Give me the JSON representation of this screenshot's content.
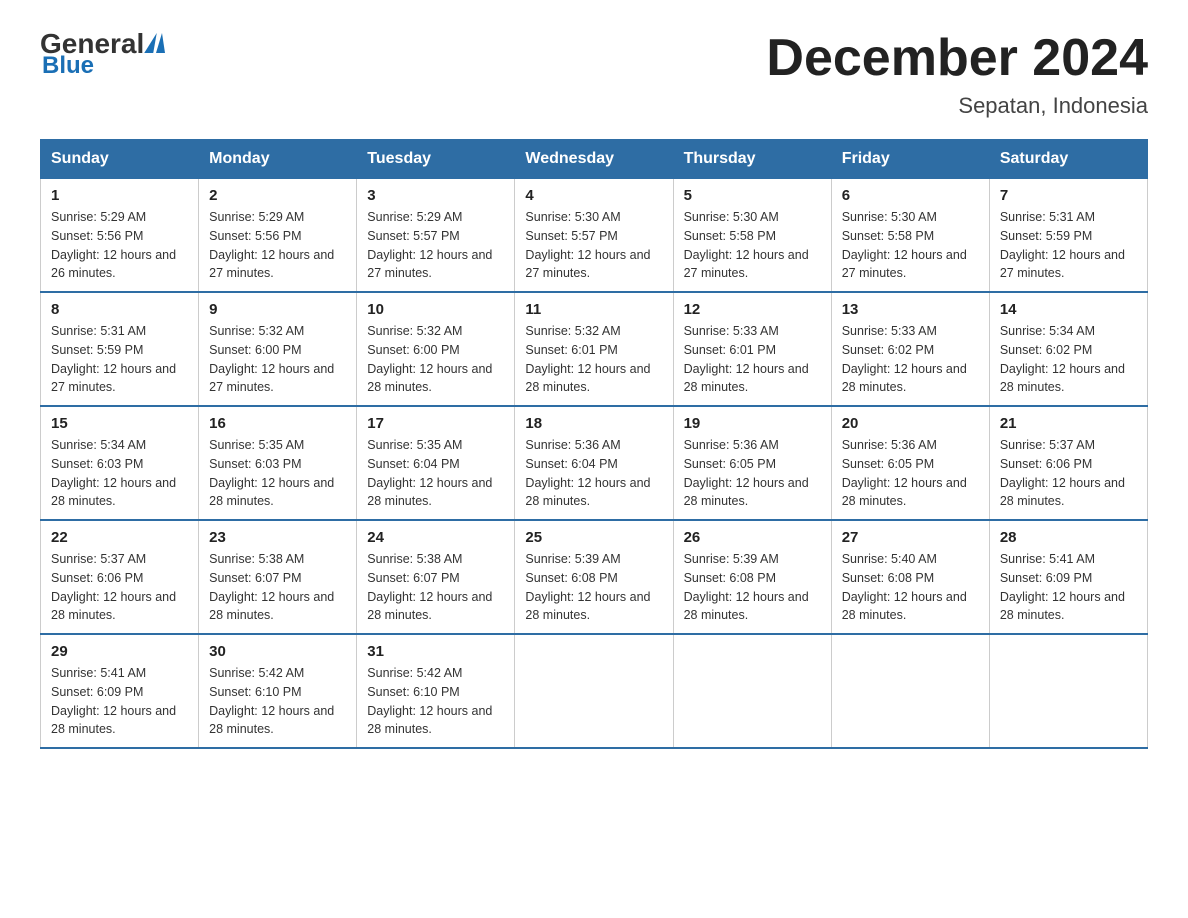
{
  "header": {
    "logo_general": "General",
    "logo_blue": "Blue",
    "title": "December 2024",
    "subtitle": "Sepatan, Indonesia"
  },
  "calendar": {
    "weekdays": [
      "Sunday",
      "Monday",
      "Tuesday",
      "Wednesday",
      "Thursday",
      "Friday",
      "Saturday"
    ],
    "rows": [
      [
        {
          "day": "1",
          "sunrise": "5:29 AM",
          "sunset": "5:56 PM",
          "daylight": "12 hours and 26 minutes."
        },
        {
          "day": "2",
          "sunrise": "5:29 AM",
          "sunset": "5:56 PM",
          "daylight": "12 hours and 27 minutes."
        },
        {
          "day": "3",
          "sunrise": "5:29 AM",
          "sunset": "5:57 PM",
          "daylight": "12 hours and 27 minutes."
        },
        {
          "day": "4",
          "sunrise": "5:30 AM",
          "sunset": "5:57 PM",
          "daylight": "12 hours and 27 minutes."
        },
        {
          "day": "5",
          "sunrise": "5:30 AM",
          "sunset": "5:58 PM",
          "daylight": "12 hours and 27 minutes."
        },
        {
          "day": "6",
          "sunrise": "5:30 AM",
          "sunset": "5:58 PM",
          "daylight": "12 hours and 27 minutes."
        },
        {
          "day": "7",
          "sunrise": "5:31 AM",
          "sunset": "5:59 PM",
          "daylight": "12 hours and 27 minutes."
        }
      ],
      [
        {
          "day": "8",
          "sunrise": "5:31 AM",
          "sunset": "5:59 PM",
          "daylight": "12 hours and 27 minutes."
        },
        {
          "day": "9",
          "sunrise": "5:32 AM",
          "sunset": "6:00 PM",
          "daylight": "12 hours and 27 minutes."
        },
        {
          "day": "10",
          "sunrise": "5:32 AM",
          "sunset": "6:00 PM",
          "daylight": "12 hours and 28 minutes."
        },
        {
          "day": "11",
          "sunrise": "5:32 AM",
          "sunset": "6:01 PM",
          "daylight": "12 hours and 28 minutes."
        },
        {
          "day": "12",
          "sunrise": "5:33 AM",
          "sunset": "6:01 PM",
          "daylight": "12 hours and 28 minutes."
        },
        {
          "day": "13",
          "sunrise": "5:33 AM",
          "sunset": "6:02 PM",
          "daylight": "12 hours and 28 minutes."
        },
        {
          "day": "14",
          "sunrise": "5:34 AM",
          "sunset": "6:02 PM",
          "daylight": "12 hours and 28 minutes."
        }
      ],
      [
        {
          "day": "15",
          "sunrise": "5:34 AM",
          "sunset": "6:03 PM",
          "daylight": "12 hours and 28 minutes."
        },
        {
          "day": "16",
          "sunrise": "5:35 AM",
          "sunset": "6:03 PM",
          "daylight": "12 hours and 28 minutes."
        },
        {
          "day": "17",
          "sunrise": "5:35 AM",
          "sunset": "6:04 PM",
          "daylight": "12 hours and 28 minutes."
        },
        {
          "day": "18",
          "sunrise": "5:36 AM",
          "sunset": "6:04 PM",
          "daylight": "12 hours and 28 minutes."
        },
        {
          "day": "19",
          "sunrise": "5:36 AM",
          "sunset": "6:05 PM",
          "daylight": "12 hours and 28 minutes."
        },
        {
          "day": "20",
          "sunrise": "5:36 AM",
          "sunset": "6:05 PM",
          "daylight": "12 hours and 28 minutes."
        },
        {
          "day": "21",
          "sunrise": "5:37 AM",
          "sunset": "6:06 PM",
          "daylight": "12 hours and 28 minutes."
        }
      ],
      [
        {
          "day": "22",
          "sunrise": "5:37 AM",
          "sunset": "6:06 PM",
          "daylight": "12 hours and 28 minutes."
        },
        {
          "day": "23",
          "sunrise": "5:38 AM",
          "sunset": "6:07 PM",
          "daylight": "12 hours and 28 minutes."
        },
        {
          "day": "24",
          "sunrise": "5:38 AM",
          "sunset": "6:07 PM",
          "daylight": "12 hours and 28 minutes."
        },
        {
          "day": "25",
          "sunrise": "5:39 AM",
          "sunset": "6:08 PM",
          "daylight": "12 hours and 28 minutes."
        },
        {
          "day": "26",
          "sunrise": "5:39 AM",
          "sunset": "6:08 PM",
          "daylight": "12 hours and 28 minutes."
        },
        {
          "day": "27",
          "sunrise": "5:40 AM",
          "sunset": "6:08 PM",
          "daylight": "12 hours and 28 minutes."
        },
        {
          "day": "28",
          "sunrise": "5:41 AM",
          "sunset": "6:09 PM",
          "daylight": "12 hours and 28 minutes."
        }
      ],
      [
        {
          "day": "29",
          "sunrise": "5:41 AM",
          "sunset": "6:09 PM",
          "daylight": "12 hours and 28 minutes."
        },
        {
          "day": "30",
          "sunrise": "5:42 AM",
          "sunset": "6:10 PM",
          "daylight": "12 hours and 28 minutes."
        },
        {
          "day": "31",
          "sunrise": "5:42 AM",
          "sunset": "6:10 PM",
          "daylight": "12 hours and 28 minutes."
        },
        null,
        null,
        null,
        null
      ]
    ]
  }
}
